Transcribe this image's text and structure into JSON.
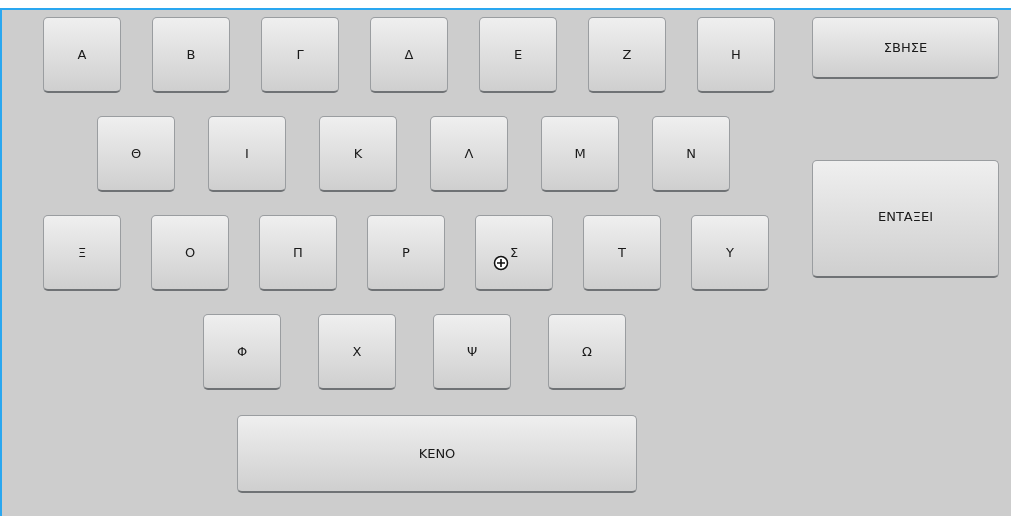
{
  "rows": [
    [
      {
        "label": "Α"
      },
      {
        "label": "Β"
      },
      {
        "label": "Γ"
      },
      {
        "label": "Δ"
      },
      {
        "label": "Ε"
      },
      {
        "label": "Ζ"
      },
      {
        "label": "Η"
      }
    ],
    [
      {
        "label": "Θ"
      },
      {
        "label": "Ι"
      },
      {
        "label": "Κ"
      },
      {
        "label": "Λ"
      },
      {
        "label": "Μ"
      },
      {
        "label": "Ν"
      }
    ],
    [
      {
        "label": "Ξ"
      },
      {
        "label": "Ο"
      },
      {
        "label": "Π"
      },
      {
        "label": "Ρ"
      },
      {
        "label": "Σ",
        "hovered": true
      },
      {
        "label": "Τ"
      },
      {
        "label": "Υ"
      }
    ],
    [
      {
        "label": "Φ"
      },
      {
        "label": "Χ"
      },
      {
        "label": "Ψ"
      },
      {
        "label": "Ω"
      }
    ]
  ],
  "space_key": {
    "label": "ΚΕΝΟ"
  },
  "delete_key": {
    "label": "ΣΒΗΣΕ"
  },
  "ok_key": {
    "label": "ΕΝΤΑΞΕΙ"
  }
}
